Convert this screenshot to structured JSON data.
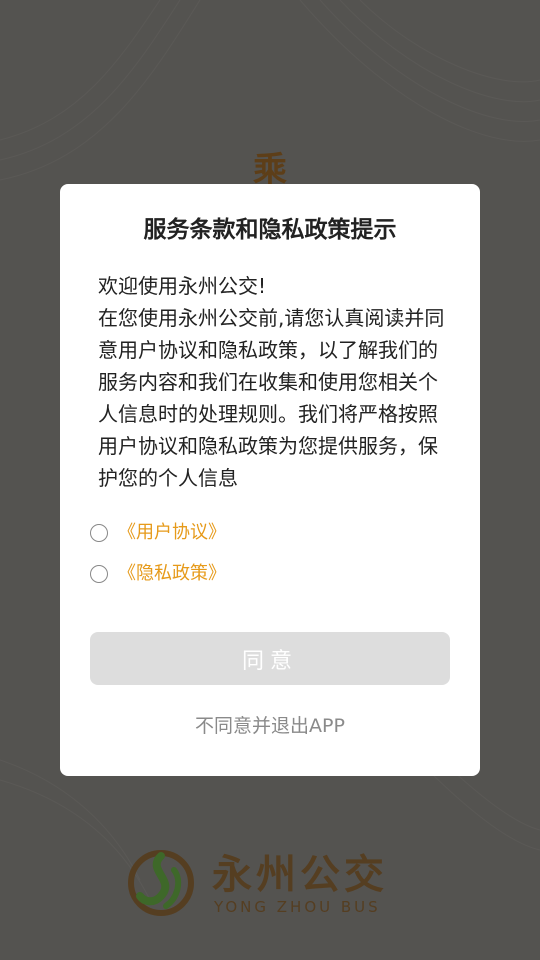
{
  "background": {
    "splash_glyph": "乘"
  },
  "dialog": {
    "title": "服务条款和隐私政策提示",
    "greeting": "欢迎使用永州公交!",
    "body": "在您使用永州公交前,请您认真阅读并同意用户协议和隐私政策，以了解我们的服务内容和我们在收集和使用您相关个人信息时的处理规则。我们将严格按照用户协议和隐私政策为您提供服务，保护您的个人信息",
    "user_agreement_link": "《用户协议》",
    "privacy_policy_link": "《隐私政策》",
    "agree_button": "同意",
    "disagree_exit": "不同意并退出APP"
  },
  "brand": {
    "name": "永州公交",
    "subtitle": "YONG ZHOU BUS"
  },
  "colors": {
    "link": "#e69a1a",
    "button_disabled": "#dddddd",
    "brand_brown": "#6e4a1e",
    "brand_green": "#4a8a2a"
  }
}
